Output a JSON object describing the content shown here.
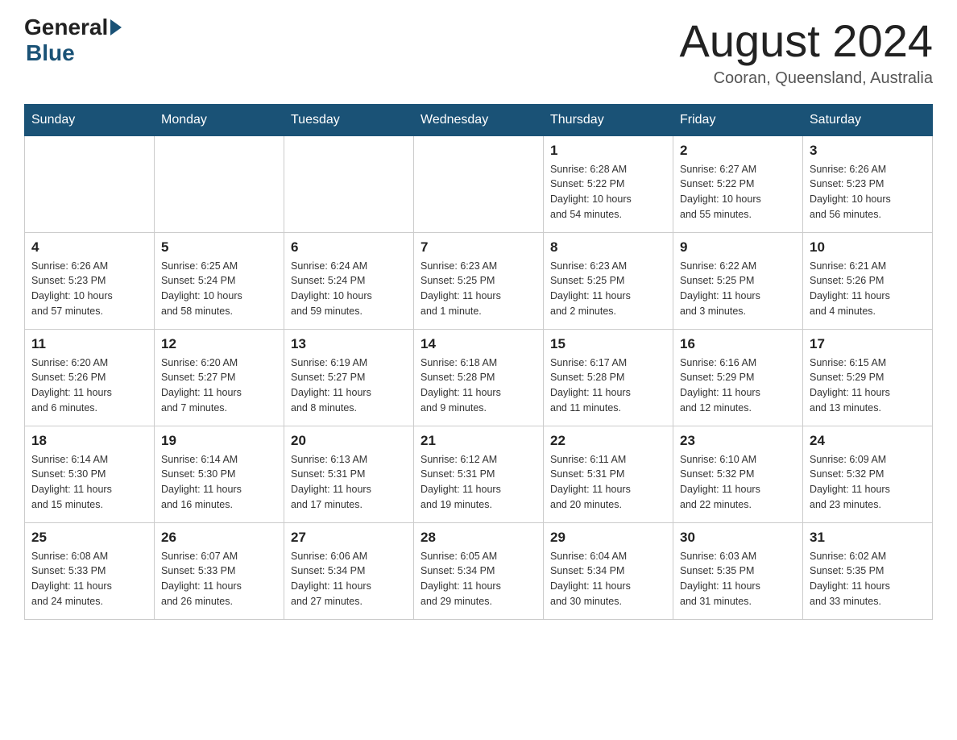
{
  "header": {
    "logo_general": "General",
    "logo_blue": "Blue",
    "month_title": "August 2024",
    "location": "Cooran, Queensland, Australia"
  },
  "days_of_week": [
    "Sunday",
    "Monday",
    "Tuesday",
    "Wednesday",
    "Thursday",
    "Friday",
    "Saturday"
  ],
  "weeks": [
    [
      {
        "day": "",
        "info": ""
      },
      {
        "day": "",
        "info": ""
      },
      {
        "day": "",
        "info": ""
      },
      {
        "day": "",
        "info": ""
      },
      {
        "day": "1",
        "info": "Sunrise: 6:28 AM\nSunset: 5:22 PM\nDaylight: 10 hours\nand 54 minutes."
      },
      {
        "day": "2",
        "info": "Sunrise: 6:27 AM\nSunset: 5:22 PM\nDaylight: 10 hours\nand 55 minutes."
      },
      {
        "day": "3",
        "info": "Sunrise: 6:26 AM\nSunset: 5:23 PM\nDaylight: 10 hours\nand 56 minutes."
      }
    ],
    [
      {
        "day": "4",
        "info": "Sunrise: 6:26 AM\nSunset: 5:23 PM\nDaylight: 10 hours\nand 57 minutes."
      },
      {
        "day": "5",
        "info": "Sunrise: 6:25 AM\nSunset: 5:24 PM\nDaylight: 10 hours\nand 58 minutes."
      },
      {
        "day": "6",
        "info": "Sunrise: 6:24 AM\nSunset: 5:24 PM\nDaylight: 10 hours\nand 59 minutes."
      },
      {
        "day": "7",
        "info": "Sunrise: 6:23 AM\nSunset: 5:25 PM\nDaylight: 11 hours\nand 1 minute."
      },
      {
        "day": "8",
        "info": "Sunrise: 6:23 AM\nSunset: 5:25 PM\nDaylight: 11 hours\nand 2 minutes."
      },
      {
        "day": "9",
        "info": "Sunrise: 6:22 AM\nSunset: 5:25 PM\nDaylight: 11 hours\nand 3 minutes."
      },
      {
        "day": "10",
        "info": "Sunrise: 6:21 AM\nSunset: 5:26 PM\nDaylight: 11 hours\nand 4 minutes."
      }
    ],
    [
      {
        "day": "11",
        "info": "Sunrise: 6:20 AM\nSunset: 5:26 PM\nDaylight: 11 hours\nand 6 minutes."
      },
      {
        "day": "12",
        "info": "Sunrise: 6:20 AM\nSunset: 5:27 PM\nDaylight: 11 hours\nand 7 minutes."
      },
      {
        "day": "13",
        "info": "Sunrise: 6:19 AM\nSunset: 5:27 PM\nDaylight: 11 hours\nand 8 minutes."
      },
      {
        "day": "14",
        "info": "Sunrise: 6:18 AM\nSunset: 5:28 PM\nDaylight: 11 hours\nand 9 minutes."
      },
      {
        "day": "15",
        "info": "Sunrise: 6:17 AM\nSunset: 5:28 PM\nDaylight: 11 hours\nand 11 minutes."
      },
      {
        "day": "16",
        "info": "Sunrise: 6:16 AM\nSunset: 5:29 PM\nDaylight: 11 hours\nand 12 minutes."
      },
      {
        "day": "17",
        "info": "Sunrise: 6:15 AM\nSunset: 5:29 PM\nDaylight: 11 hours\nand 13 minutes."
      }
    ],
    [
      {
        "day": "18",
        "info": "Sunrise: 6:14 AM\nSunset: 5:30 PM\nDaylight: 11 hours\nand 15 minutes."
      },
      {
        "day": "19",
        "info": "Sunrise: 6:14 AM\nSunset: 5:30 PM\nDaylight: 11 hours\nand 16 minutes."
      },
      {
        "day": "20",
        "info": "Sunrise: 6:13 AM\nSunset: 5:31 PM\nDaylight: 11 hours\nand 17 minutes."
      },
      {
        "day": "21",
        "info": "Sunrise: 6:12 AM\nSunset: 5:31 PM\nDaylight: 11 hours\nand 19 minutes."
      },
      {
        "day": "22",
        "info": "Sunrise: 6:11 AM\nSunset: 5:31 PM\nDaylight: 11 hours\nand 20 minutes."
      },
      {
        "day": "23",
        "info": "Sunrise: 6:10 AM\nSunset: 5:32 PM\nDaylight: 11 hours\nand 22 minutes."
      },
      {
        "day": "24",
        "info": "Sunrise: 6:09 AM\nSunset: 5:32 PM\nDaylight: 11 hours\nand 23 minutes."
      }
    ],
    [
      {
        "day": "25",
        "info": "Sunrise: 6:08 AM\nSunset: 5:33 PM\nDaylight: 11 hours\nand 24 minutes."
      },
      {
        "day": "26",
        "info": "Sunrise: 6:07 AM\nSunset: 5:33 PM\nDaylight: 11 hours\nand 26 minutes."
      },
      {
        "day": "27",
        "info": "Sunrise: 6:06 AM\nSunset: 5:34 PM\nDaylight: 11 hours\nand 27 minutes."
      },
      {
        "day": "28",
        "info": "Sunrise: 6:05 AM\nSunset: 5:34 PM\nDaylight: 11 hours\nand 29 minutes."
      },
      {
        "day": "29",
        "info": "Sunrise: 6:04 AM\nSunset: 5:34 PM\nDaylight: 11 hours\nand 30 minutes."
      },
      {
        "day": "30",
        "info": "Sunrise: 6:03 AM\nSunset: 5:35 PM\nDaylight: 11 hours\nand 31 minutes."
      },
      {
        "day": "31",
        "info": "Sunrise: 6:02 AM\nSunset: 5:35 PM\nDaylight: 11 hours\nand 33 minutes."
      }
    ]
  ]
}
